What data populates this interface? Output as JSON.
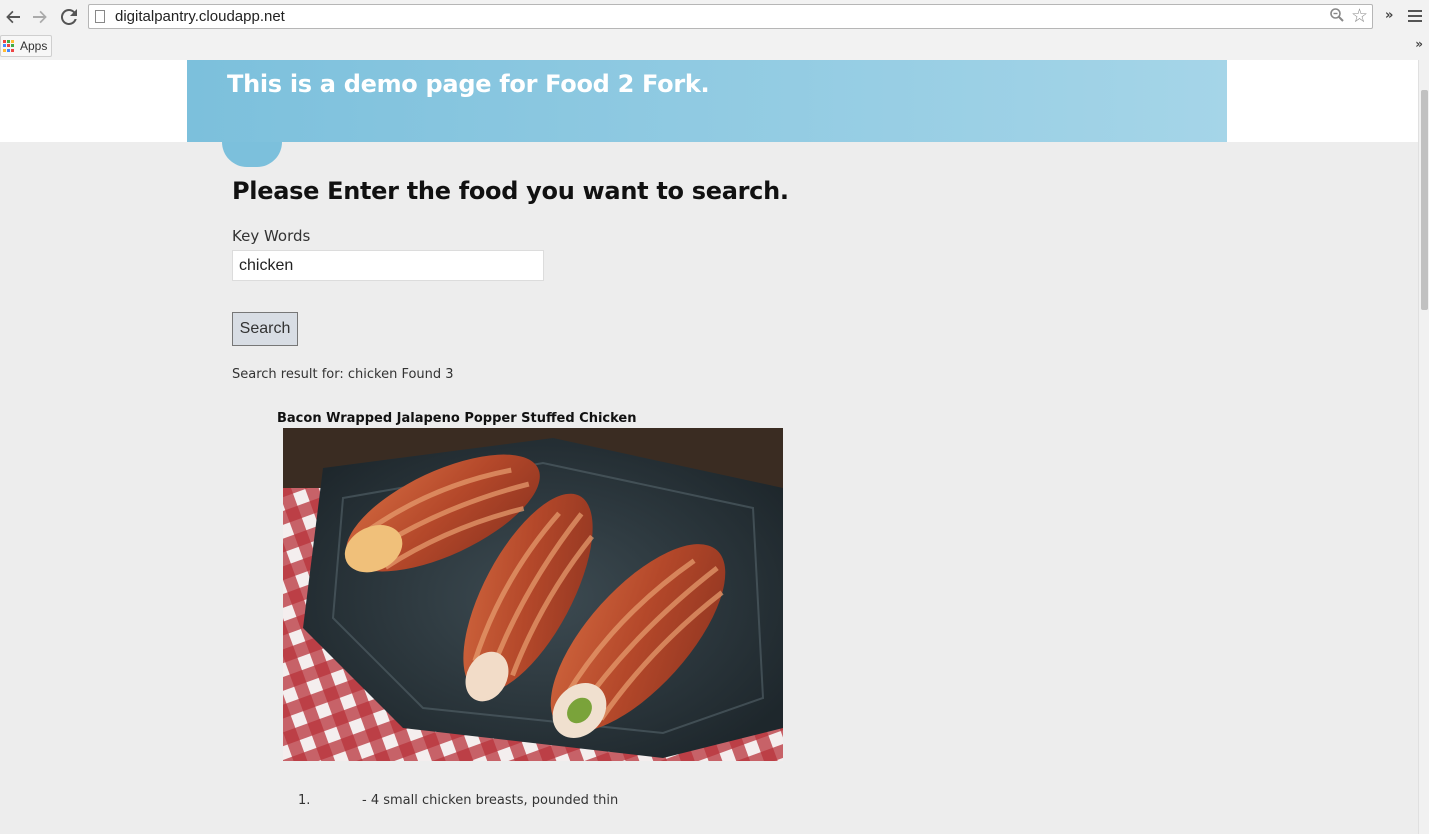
{
  "browser": {
    "url": "digitalpantry.cloudapp.net",
    "bookmarks": {
      "apps_label": "Apps"
    },
    "icons": {
      "back": "back-arrow-icon",
      "forward": "forward-arrow-icon",
      "reload": "reload-icon",
      "page": "page-icon",
      "zoom": "zoom-icon",
      "bookmark": "star-icon",
      "extensions": "chevron-right-icon",
      "menu": "hamburger-menu-icon"
    }
  },
  "header": {
    "title": "This is a demo page for Food 2 Fork.",
    "banner_color": "#7cc0dc"
  },
  "search": {
    "heading": "Please Enter the food you want to search.",
    "field_label": "Key Words",
    "value": "chicken",
    "button_label": "Search",
    "result_text": "Search result for: chicken Found 3"
  },
  "results": [
    {
      "title": "Bacon Wrapped Jalapeno Popper Stuffed Chicken",
      "ingredients": [
        {
          "number": "1.",
          "text": "- 4 small chicken breasts, pounded thin"
        }
      ]
    }
  ]
}
